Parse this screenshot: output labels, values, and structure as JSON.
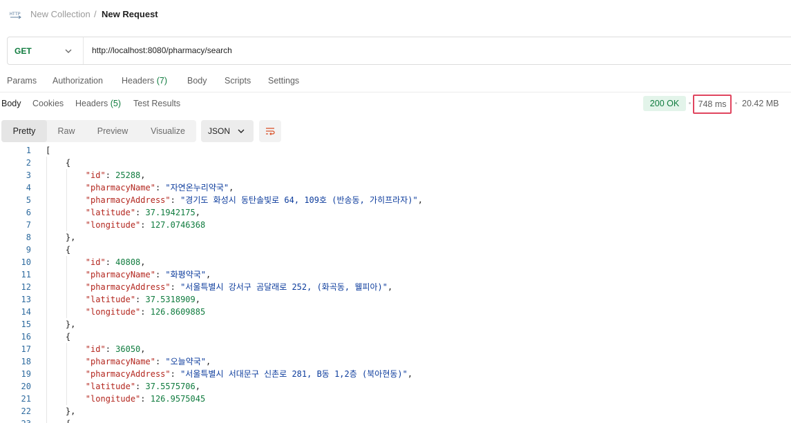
{
  "breadcrumb": {
    "icon": "http-icon",
    "parent": "New Collection",
    "separator": "/",
    "current": "New Request"
  },
  "request": {
    "method": "GET",
    "url": "http://localhost:8080/pharmacy/search"
  },
  "request_tabs": [
    {
      "label": "Params"
    },
    {
      "label": "Authorization"
    },
    {
      "label": "Headers",
      "count": "(7)"
    },
    {
      "label": "Body"
    },
    {
      "label": "Scripts"
    },
    {
      "label": "Settings"
    }
  ],
  "response_tabs": [
    {
      "label": "Body",
      "active": true
    },
    {
      "label": "Cookies"
    },
    {
      "label": "Headers",
      "count": "(5)"
    },
    {
      "label": "Test Results"
    }
  ],
  "response_meta": {
    "status": "200 OK",
    "time": "748 ms",
    "size": "20.42 MB",
    "status_color": "#0f7b3e",
    "highlight_color": "#e0445e"
  },
  "view_modes": [
    "Pretty",
    "Raw",
    "Preview",
    "Visualize"
  ],
  "active_view": "Pretty",
  "format": "JSON",
  "wrap_icon": "wrap-lines-icon",
  "code_lines": [
    {
      "n": "1",
      "parts": [
        [
          "p",
          "["
        ]
      ]
    },
    {
      "n": "2",
      "parts": [
        [
          "p",
          "    {"
        ]
      ]
    },
    {
      "n": "3",
      "parts": [
        [
          "p",
          "        "
        ],
        [
          "k",
          "\"id\""
        ],
        [
          "p",
          ": "
        ],
        [
          "n",
          "25288"
        ],
        [
          "p",
          ","
        ]
      ]
    },
    {
      "n": "4",
      "parts": [
        [
          "p",
          "        "
        ],
        [
          "k",
          "\"pharmacyName\""
        ],
        [
          "p",
          ": "
        ],
        [
          "s",
          "\"자연온누리약국\""
        ],
        [
          "p",
          ","
        ]
      ]
    },
    {
      "n": "5",
      "parts": [
        [
          "p",
          "        "
        ],
        [
          "k",
          "\"pharmacyAddress\""
        ],
        [
          "p",
          ": "
        ],
        [
          "s",
          "\"경기도 화성시 동탄솔빛로 64, 109호 (반송동, 가히프라자)\""
        ],
        [
          "p",
          ","
        ]
      ]
    },
    {
      "n": "6",
      "parts": [
        [
          "p",
          "        "
        ],
        [
          "k",
          "\"latitude\""
        ],
        [
          "p",
          ": "
        ],
        [
          "n",
          "37.1942175"
        ],
        [
          "p",
          ","
        ]
      ]
    },
    {
      "n": "7",
      "parts": [
        [
          "p",
          "        "
        ],
        [
          "k",
          "\"longitude\""
        ],
        [
          "p",
          ": "
        ],
        [
          "n",
          "127.0746368"
        ]
      ]
    },
    {
      "n": "8",
      "parts": [
        [
          "p",
          "    },"
        ]
      ]
    },
    {
      "n": "9",
      "parts": [
        [
          "p",
          "    {"
        ]
      ]
    },
    {
      "n": "10",
      "parts": [
        [
          "p",
          "        "
        ],
        [
          "k",
          "\"id\""
        ],
        [
          "p",
          ": "
        ],
        [
          "n",
          "40808"
        ],
        [
          "p",
          ","
        ]
      ]
    },
    {
      "n": "11",
      "parts": [
        [
          "p",
          "        "
        ],
        [
          "k",
          "\"pharmacyName\""
        ],
        [
          "p",
          ": "
        ],
        [
          "s",
          "\"화평약국\""
        ],
        [
          "p",
          ","
        ]
      ]
    },
    {
      "n": "12",
      "parts": [
        [
          "p",
          "        "
        ],
        [
          "k",
          "\"pharmacyAddress\""
        ],
        [
          "p",
          ": "
        ],
        [
          "s",
          "\"서울특별시 강서구 곰달래로 252, (화곡동, 웰피아)\""
        ],
        [
          "p",
          ","
        ]
      ]
    },
    {
      "n": "13",
      "parts": [
        [
          "p",
          "        "
        ],
        [
          "k",
          "\"latitude\""
        ],
        [
          "p",
          ": "
        ],
        [
          "n",
          "37.5318909"
        ],
        [
          "p",
          ","
        ]
      ]
    },
    {
      "n": "14",
      "parts": [
        [
          "p",
          "        "
        ],
        [
          "k",
          "\"longitude\""
        ],
        [
          "p",
          ": "
        ],
        [
          "n",
          "126.8609885"
        ]
      ]
    },
    {
      "n": "15",
      "parts": [
        [
          "p",
          "    },"
        ]
      ]
    },
    {
      "n": "16",
      "parts": [
        [
          "p",
          "    {"
        ]
      ]
    },
    {
      "n": "17",
      "parts": [
        [
          "p",
          "        "
        ],
        [
          "k",
          "\"id\""
        ],
        [
          "p",
          ": "
        ],
        [
          "n",
          "36050"
        ],
        [
          "p",
          ","
        ]
      ]
    },
    {
      "n": "18",
      "parts": [
        [
          "p",
          "        "
        ],
        [
          "k",
          "\"pharmacyName\""
        ],
        [
          "p",
          ": "
        ],
        [
          "s",
          "\"오늘약국\""
        ],
        [
          "p",
          ","
        ]
      ]
    },
    {
      "n": "19",
      "parts": [
        [
          "p",
          "        "
        ],
        [
          "k",
          "\"pharmacyAddress\""
        ],
        [
          "p",
          ": "
        ],
        [
          "s",
          "\"서울특별시 서대문구 신촌로 281, B동 1,2층 (북아현동)\""
        ],
        [
          "p",
          ","
        ]
      ]
    },
    {
      "n": "20",
      "parts": [
        [
          "p",
          "        "
        ],
        [
          "k",
          "\"latitude\""
        ],
        [
          "p",
          ": "
        ],
        [
          "n",
          "37.5575706"
        ],
        [
          "p",
          ","
        ]
      ]
    },
    {
      "n": "21",
      "parts": [
        [
          "p",
          "        "
        ],
        [
          "k",
          "\"longitude\""
        ],
        [
          "p",
          ": "
        ],
        [
          "n",
          "126.9575045"
        ]
      ]
    },
    {
      "n": "22",
      "parts": [
        [
          "p",
          "    },"
        ]
      ]
    },
    {
      "n": "23",
      "parts": [
        [
          "p",
          "    {"
        ]
      ]
    }
  ]
}
